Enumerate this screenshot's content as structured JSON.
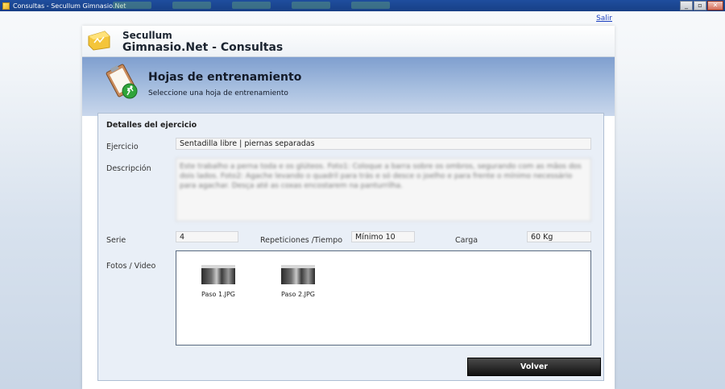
{
  "window": {
    "title": "Consultas - Secullum Gimnasio.Net",
    "minimize": "_",
    "maximize": "▫",
    "close": "✕"
  },
  "header": {
    "logout": "Salir",
    "brand": "Secullum",
    "app_name": "Gimnasio.Net - Consultas"
  },
  "section": {
    "title": "Hojas de entrenamiento",
    "subtitle": "Seleccione una hoja de entrenamiento"
  },
  "details": {
    "title": "Detalles del ejercicio",
    "ejercicio_label": "Ejercicio",
    "ejercicio_value": "Sentadilla libre | piernas separadas",
    "descripcion_label": "Descripción",
    "descripcion_value": "Este trabalho a perna toda e os glúteos. Foto1: Coloque a barra sobre os ombros, segurando com as mãos dos dois lados. Foto2: Agache levando o quadril para trás e só desce o joelho e para frente o mínimo necessário para agachar. Desça até as coxas encostarem na panturrilha.",
    "serie_label": "Serie",
    "serie_value": "4",
    "repeticiones_label": "Repeticiones /Tiempo",
    "repeticiones_value": "Mínimo 10",
    "carga_label": "Carga",
    "carga_value": "60 Kg",
    "fotos_label": "Fotos / Video",
    "photos": [
      {
        "name": "Paso 1.JPG"
      },
      {
        "name": "Paso 2.JPG"
      }
    ],
    "back_button": "Volver"
  },
  "colors": {
    "accent_band": "#a9c0e0",
    "link": "#1a3fbf",
    "button_dark": "#111111"
  }
}
